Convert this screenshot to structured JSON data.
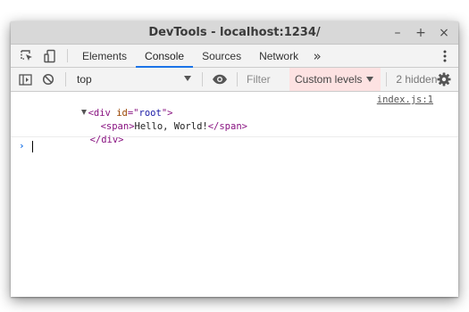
{
  "window": {
    "title": "DevTools - localhost:1234/",
    "minimize_label": "–",
    "maximize_label": "+",
    "close_label": "×"
  },
  "tabs": [
    {
      "label": "Elements",
      "active": false
    },
    {
      "label": "Console",
      "active": true
    },
    {
      "label": "Sources",
      "active": false
    },
    {
      "label": "Network",
      "active": false
    }
  ],
  "tabs_more_label": "»",
  "toolbar": {
    "context": "top",
    "filter_placeholder": "Filter",
    "levels_label": "Custom levels",
    "hidden_count": "2 hidden"
  },
  "console": {
    "message": {
      "source": "index.js:1",
      "lines": [
        {
          "open": "<",
          "tag": "div",
          "attr": "id",
          "eq": "=\"",
          "val": "root",
          "close": "\">"
        },
        {
          "open": "<",
          "tag": "span",
          "close": ">",
          "text": "Hello, World!",
          "endtag": "</span>"
        },
        {
          "endtag": "</div>"
        }
      ]
    },
    "prompt": "›"
  },
  "colors": {
    "accent": "#1a73e8",
    "tag": "#881280",
    "attr_name": "#994500",
    "attr_value": "#1a1aa6",
    "levels_bg": "#fde2e2"
  },
  "icons": {
    "inspect": "inspect-element-icon",
    "device": "device-toolbar-icon",
    "sidebar": "console-sidebar-icon",
    "clear": "clear-console-icon",
    "eye": "live-expression-eye-icon",
    "gear": "settings-gear-icon",
    "kebab": "more-options-icon"
  }
}
